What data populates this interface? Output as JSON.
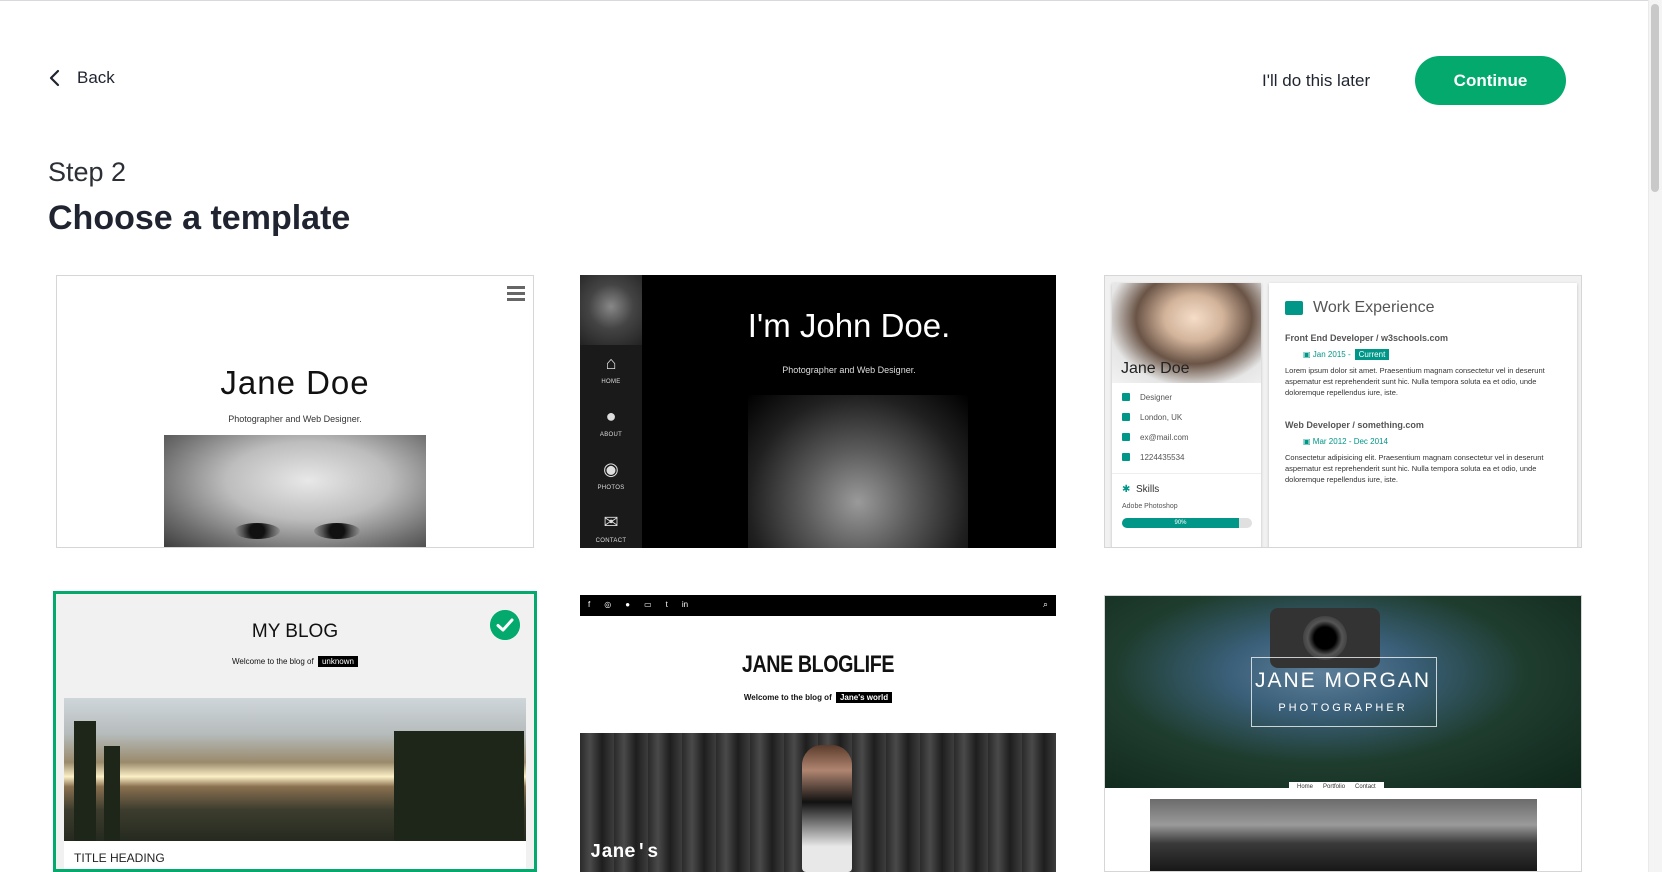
{
  "header": {
    "back_label": "Back",
    "later_label": "I'll do this later",
    "continue_label": "Continue"
  },
  "page": {
    "step": "Step 2",
    "title": "Choose a template"
  },
  "colors": {
    "accent": "#04aa6d",
    "teal": "#009688"
  },
  "templates": [
    {
      "name": "Jane Doe",
      "subtitle": "Photographer and Web Designer."
    },
    {
      "name": "I'm John Doe.",
      "subtitle": "Photographer and Web Designer.",
      "nav": [
        {
          "icon": "home-icon",
          "label": "HOME"
        },
        {
          "icon": "user-icon",
          "label": "ABOUT"
        },
        {
          "icon": "eye-icon",
          "label": "PHOTOS"
        },
        {
          "icon": "envelope-icon",
          "label": "CONTACT"
        }
      ]
    },
    {
      "name": "Jane Doe",
      "info": [
        "Designer",
        "London, UK",
        "ex@mail.com",
        "1224435534"
      ],
      "skills_label": "Skills",
      "skill": "Adobe Photoshop",
      "skill_pct": "90%",
      "section_title": "Work Experience",
      "jobs": [
        {
          "title": "Front End Developer / w3schools.com",
          "date": "Jan 2015 -",
          "badge": "Current",
          "text": "Lorem ipsum dolor sit amet. Praesentium magnam consectetur vel in deserunt aspernatur est reprehenderit sunt hic. Nulla tempora soluta ea et odio, unde doloremque repellendus iure, iste."
        },
        {
          "title": "Web Developer / something.com",
          "date": "Mar 2012 - Dec 2014",
          "badge": "",
          "text": "Consectetur adipisicing elit. Praesentium magnam consectetur vel in deserunt aspernatur est reprehenderit sunt hic. Nulla tempora soluta ea et odio, unde doloremque repellendus iure, iste."
        }
      ]
    },
    {
      "name": "MY BLOG",
      "welcome": "Welcome to the blog of",
      "tag": "unknown",
      "heading": "TITLE HEADING",
      "selected": true
    },
    {
      "name": "JANE BLOGLIFE",
      "welcome": "Welcome to the blog of",
      "tag": "Jane's world",
      "caption": "Jane's",
      "social": [
        "f",
        "◎",
        "●",
        "▭",
        "t",
        "in"
      ]
    },
    {
      "name": "JANE MORGAN",
      "subtitle": "PHOTOGRAPHER",
      "menu": [
        "Home",
        "Portfolio",
        "Contact"
      ]
    }
  ]
}
